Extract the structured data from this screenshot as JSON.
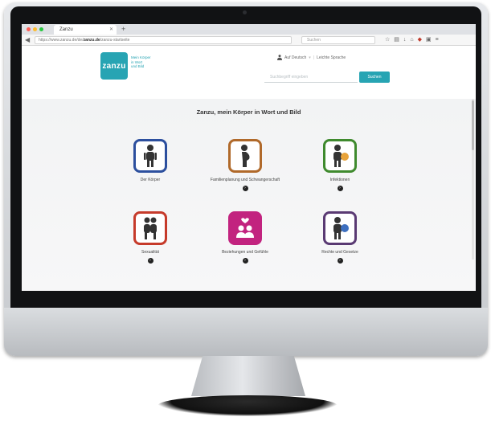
{
  "browser": {
    "tab_title": "Zanzu",
    "new_tab": "+",
    "address_prefix": "https://www.zanzu.de/de/",
    "address_host": "zanzu.de",
    "address_suffix": "/zanzu-startseite",
    "search_placeholder": "Suchen",
    "icons": [
      "star-icon",
      "bookmarks-icon",
      "download-icon",
      "home-icon",
      "shield-icon",
      "extension-icon",
      "menu-icon"
    ]
  },
  "site": {
    "logo": "zanzu",
    "tagline": [
      "Mein Körper",
      "in Wort",
      "und Bild"
    ],
    "language_label": "Auf Deutsch",
    "language_icon": "person-icon",
    "extra_label": "Leichte Sprache",
    "search_placeholder": "Suchbegriff eingeben",
    "search_button": "Suchen"
  },
  "main": {
    "heading": "Zanzu, mein Körper in Wort und Bild",
    "categories": [
      {
        "label": "Der Körper",
        "color": "#2c4f9e",
        "icon": "body-icon"
      },
      {
        "label": "Familienplanung und Schwangerschaft",
        "color": "#b0692a",
        "icon": "pregnancy-icon"
      },
      {
        "label": "Infektionen",
        "color": "#3f8a2e",
        "icon": "infection-icon"
      },
      {
        "label": "Sexualität",
        "color": "#c63b2b",
        "icon": "couple-icon"
      },
      {
        "label": "Beziehungen und Gefühle",
        "color": "#c2237f",
        "icon": "relationship-icon"
      },
      {
        "label": "Rechte und Gesetze",
        "color": "#5a3a73",
        "icon": "rights-icon"
      }
    ],
    "more_glyph": "›"
  }
}
